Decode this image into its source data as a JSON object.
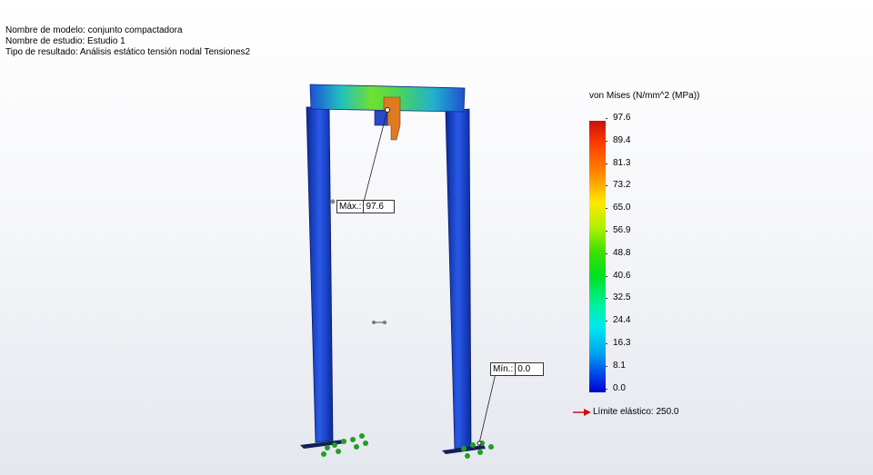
{
  "header": {
    "model_name": "Nombre de modelo: conjunto compactadora",
    "study_name": "Nombre de estudio: Estudio 1",
    "result_type": "Tipo de resultado: Análisis estático tensión nodal Tensiones2"
  },
  "legend": {
    "title": "von Mises (N/mm^2 (MPa))",
    "ticks": [
      "97.6",
      "89.4",
      "81.3",
      "73.2",
      "65.0",
      "56.9",
      "48.8",
      "40.6",
      "32.5",
      "24.4",
      "16.3",
      "8.1",
      "0.0"
    ],
    "yield_label": "Límite elástico: 250.0",
    "yield_arrow_color": "#d01010"
  },
  "probes": {
    "max_label": "Máx.:",
    "max_value": "97.6",
    "min_label": "Mín.:",
    "min_value": "0.0"
  }
}
